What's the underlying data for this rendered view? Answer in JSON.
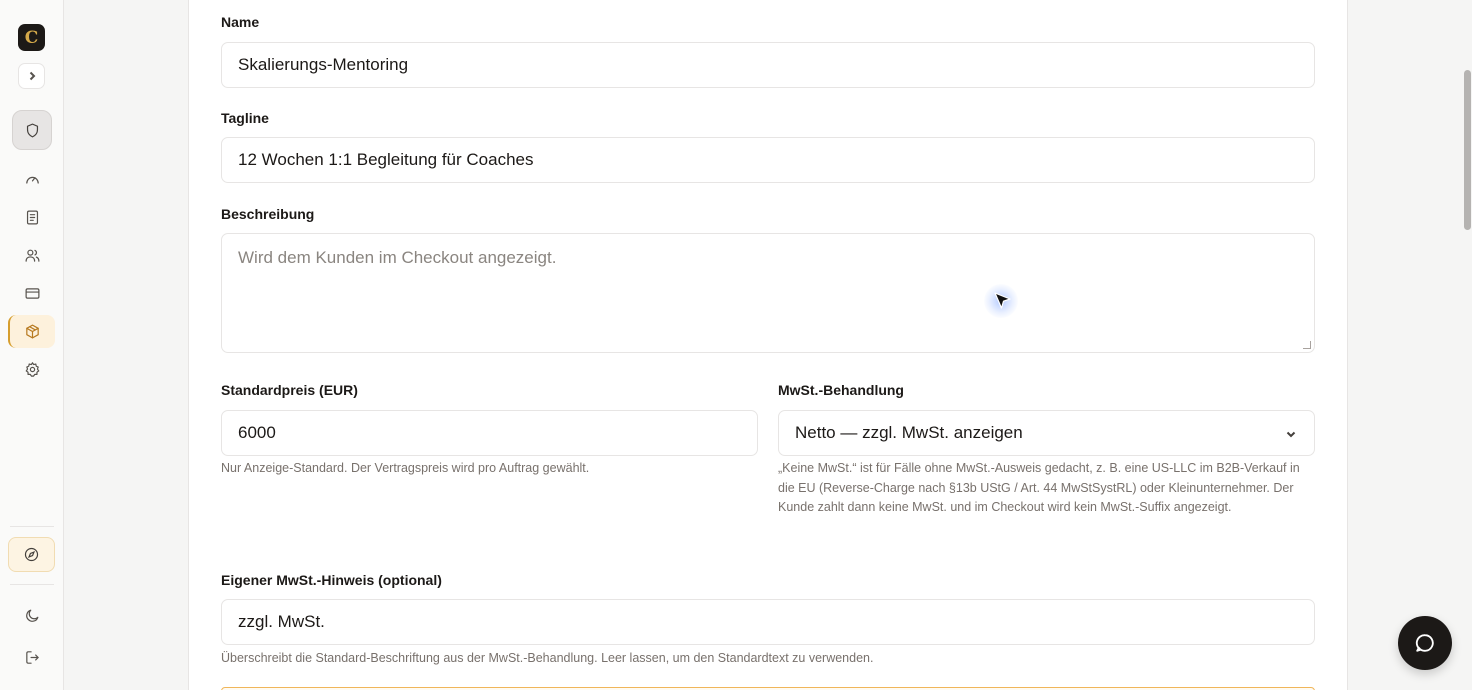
{
  "sidebar": {
    "logo_letter": "C",
    "items": [
      {
        "name": "dashboard",
        "icon": "gauge-icon"
      },
      {
        "name": "documents",
        "icon": "document-icon"
      },
      {
        "name": "clients",
        "icon": "users-icon"
      },
      {
        "name": "payments",
        "icon": "credit-card-icon"
      },
      {
        "name": "products",
        "icon": "package-icon",
        "active": true
      },
      {
        "name": "settings",
        "icon": "gear-icon"
      }
    ]
  },
  "form": {
    "name_label": "Name",
    "name_value": "Skalierungs-Mentoring",
    "tagline_label": "Tagline",
    "tagline_value": "12 Wochen 1:1 Begleitung für Coaches",
    "description_label": "Beschreibung",
    "description_placeholder": "Wird dem Kunden im Checkout angezeigt.",
    "price_label": "Standardpreis (EUR)",
    "price_value": "6000",
    "price_hint": "Nur Anzeige-Standard. Der Vertragspreis wird pro Auftrag gewählt.",
    "vat_label": "MwSt.-Behandlung",
    "vat_value": "Netto — zzgl. MwSt. anzeigen",
    "vat_hint": "„Keine MwSt.“ ist für Fälle ohne MwSt.-Ausweis gedacht, z. B. eine US-LLC im B2B-Verkauf in die EU (Reverse-Charge nach §13b UStG / Art. 44 MwStSystRL) oder Kleinunternehmer. Der Kunde zahlt dann keine MwSt. und im Checkout wird kein MwSt.-Suffix angezeigt.",
    "vat_note_label": "Eigener MwSt.-Hinweis (optional)",
    "vat_note_value": "zzgl. MwSt.",
    "vat_note_hint": "Überschreibt die Standard-Beschriftung aus der MwSt.-Behandlung. Leer lassen, um den Standardtext zu verwenden."
  },
  "colors": {
    "accent": "#d69e2e",
    "sidebar_bg": "#fafaf9",
    "card_bg": "#ffffff",
    "fab_bg": "#1c1917"
  }
}
